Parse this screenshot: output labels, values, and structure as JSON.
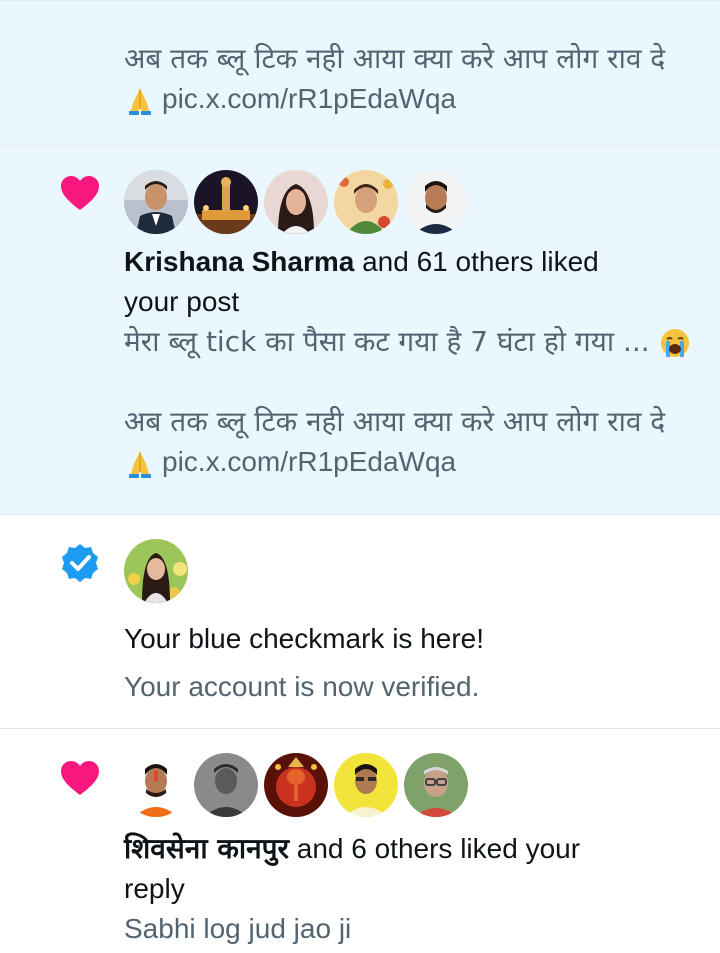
{
  "notifications": [
    {
      "type": "tweet-continuation",
      "lines": [
        {
          "text": "अब तक ब्लू टिक नही आया क्या करे आप लोग राव दे"
        },
        {
          "emoji": "folded-hands",
          "text": "pic.x.com/rR1pEdaWqa"
        }
      ]
    },
    {
      "type": "like",
      "icon": "heart-icon",
      "accent": "#f91880",
      "avatars": [
        "avatar-man-suit",
        "avatar-statue-night",
        "avatar-woman",
        "avatar-woman-flowers",
        "avatar-man-beard"
      ],
      "actor": "Krishana Sharma",
      "action_first": " and 61 others liked",
      "action_second": "your post",
      "preview": "मेरा ब्लू tick का पैसा कट गया है  7 घंटा हो गया ...",
      "preview_emoji": "crying-face",
      "body_lines": [
        {
          "text": "अब तक ब्लू टिक नही आया क्या करे आप लोग राव दे"
        },
        {
          "emoji": "folded-hands",
          "text": "pic.x.com/rR1pEdaWqa"
        }
      ]
    },
    {
      "type": "verified",
      "icon": "verified-badge-icon",
      "accent": "#1d9bf0",
      "avatars": [
        "avatar-girl-garden"
      ],
      "title": "Your blue checkmark is here!",
      "subtitle": "Your account is now verified."
    },
    {
      "type": "like",
      "icon": "heart-icon",
      "accent": "#f91880",
      "avatars": [
        "avatar-man-tilak",
        "avatar-man-grey",
        "avatar-ganesha",
        "avatar-man-yellow",
        "avatar-man-glasses"
      ],
      "actor": "शिवसेना कानपुर",
      "action_first": " and 6 others liked your",
      "action_second": "reply",
      "preview": "Sabhi log jud jao ji"
    }
  ]
}
